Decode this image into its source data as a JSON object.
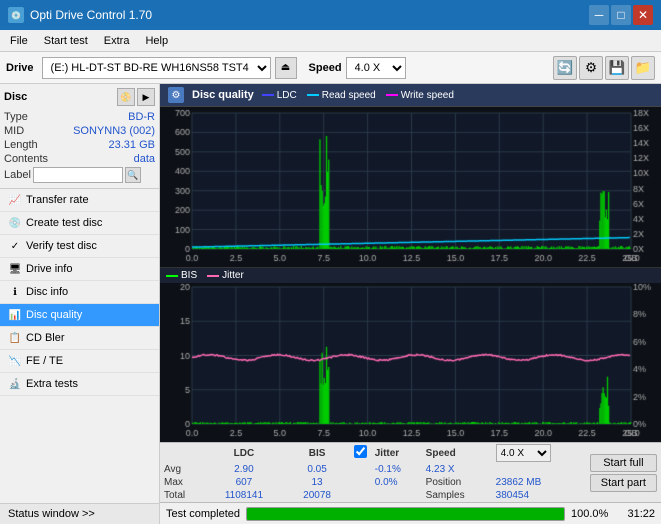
{
  "app": {
    "title": "Opti Drive Control 1.70",
    "title_icon": "💿"
  },
  "menu": {
    "items": [
      "File",
      "Start test",
      "Extra",
      "Help"
    ]
  },
  "drive_toolbar": {
    "label": "Drive",
    "drive_value": "(E:)  HL-DT-ST BD-RE  WH16NS58 TST4",
    "speed_label": "Speed",
    "speed_value": "4.0 X"
  },
  "disc_section": {
    "title": "Disc",
    "type_label": "Type",
    "type_value": "BD-R",
    "mid_label": "MID",
    "mid_value": "SONYNN3 (002)",
    "length_label": "Length",
    "length_value": "23.31 GB",
    "contents_label": "Contents",
    "contents_value": "data",
    "label_label": "Label"
  },
  "nav_items": [
    {
      "id": "transfer-rate",
      "label": "Transfer rate",
      "icon": "📈"
    },
    {
      "id": "create-test-disc",
      "label": "Create test disc",
      "icon": "💿"
    },
    {
      "id": "verify-test-disc",
      "label": "Verify test disc",
      "icon": "✓"
    },
    {
      "id": "drive-info",
      "label": "Drive info",
      "icon": "🖥"
    },
    {
      "id": "disc-info",
      "label": "Disc info",
      "icon": "ℹ"
    },
    {
      "id": "disc-quality",
      "label": "Disc quality",
      "icon": "📊",
      "active": true
    },
    {
      "id": "cd-bler",
      "label": "CD Bler",
      "icon": "📋"
    },
    {
      "id": "fe-te",
      "label": "FE / TE",
      "icon": "📉"
    },
    {
      "id": "extra-tests",
      "label": "Extra tests",
      "icon": "🔬"
    }
  ],
  "status_window": {
    "label": "Status window >>"
  },
  "disc_quality": {
    "title": "Disc quality",
    "legend": {
      "ldc": "LDC",
      "read_speed": "Read speed",
      "write_speed": "Write speed",
      "bis": "BIS",
      "jitter": "Jitter"
    }
  },
  "stats": {
    "headers": [
      "",
      "LDC",
      "BIS",
      "",
      "Jitter",
      "Speed",
      ""
    ],
    "avg_label": "Avg",
    "avg_ldc": "2.90",
    "avg_bis": "0.05",
    "avg_jitter": "-0.1%",
    "max_label": "Max",
    "max_ldc": "607",
    "max_bis": "13",
    "max_jitter": "0.0%",
    "total_label": "Total",
    "total_ldc": "1108141",
    "total_bis": "20078",
    "speed_label": "Speed",
    "speed_value": "4.23 X",
    "speed_select": "4.0 X",
    "position_label": "Position",
    "position_value": "23862 MB",
    "samples_label": "Samples",
    "samples_value": "380454",
    "jitter_checked": true,
    "jitter_label": "Jitter"
  },
  "buttons": {
    "start_full": "Start full",
    "start_part": "Start part"
  },
  "bottom": {
    "status": "Test completed",
    "progress": 100,
    "progress_text": "100.0%",
    "time": "31:22"
  },
  "colors": {
    "ldc": "#00ff00",
    "read_speed": "#00ffff",
    "write_speed": "#ff00ff",
    "bis": "#00ff00",
    "jitter": "#ff69b4",
    "grid": "#2a3a4a",
    "bg": "#0a0a1a",
    "chart_bg": "#111827"
  }
}
